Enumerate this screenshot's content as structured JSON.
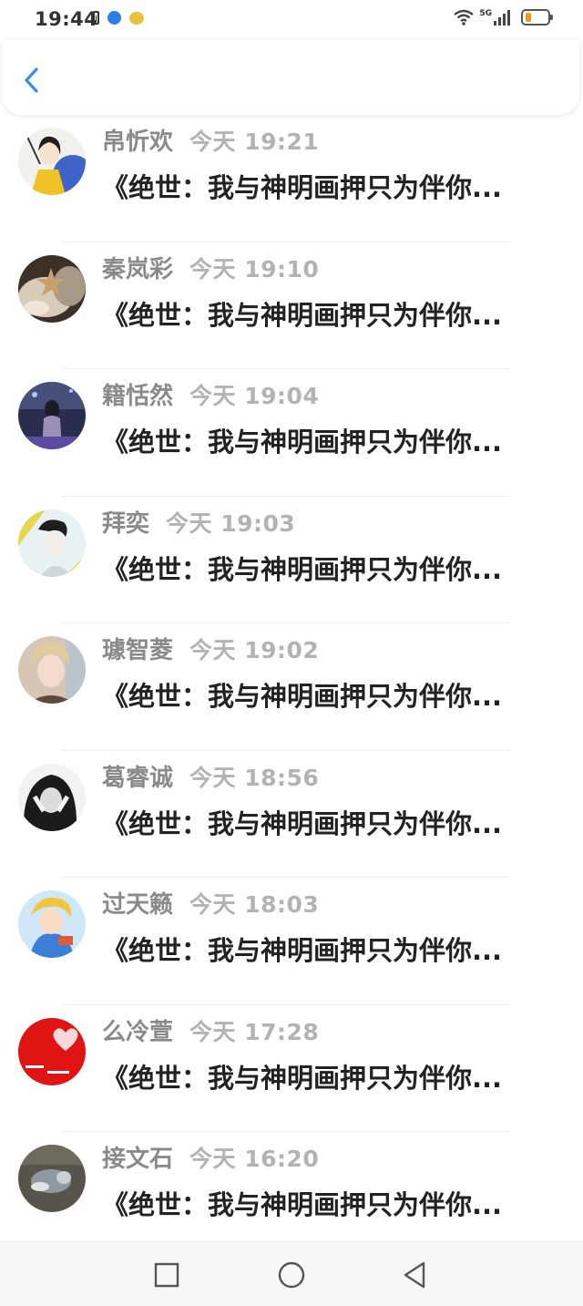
{
  "status_bar": {
    "time": "19:44",
    "network": "5G",
    "icons": [
      "battery-saver-icon",
      "browser-icon",
      "emoji-app-icon",
      "wifi-icon",
      "cellular-signal-icon",
      "battery-icon"
    ]
  },
  "header": {
    "back_icon": "chevron-left-icon",
    "accent_color": "#3a8de6"
  },
  "list": {
    "items": [
      {
        "name": "帛忻欢",
        "time": "今天 19:21",
        "title": "《绝世：我与神明画押只为伴你...",
        "avatar": "illustrated-woman-avatar"
      },
      {
        "name": "秦岚彩",
        "time": "今天 19:10",
        "title": "《绝世：我与神明画押只为伴你...",
        "avatar": "starfish-photo-avatar"
      },
      {
        "name": "籍恬然",
        "time": "今天 19:04",
        "title": "《绝世：我与神明画押只为伴你...",
        "avatar": "girl-night-avatar"
      },
      {
        "name": "拜奕",
        "time": "今天 19:03",
        "title": "《绝世：我与神明画押只为伴你...",
        "avatar": "boy-yellow-avatar"
      },
      {
        "name": "璩智菱",
        "time": "今天 19:02",
        "title": "《绝世：我与神明画押只为伴你...",
        "avatar": "young-man-avatar"
      },
      {
        "name": "葛睿诚",
        "time": "今天 18:56",
        "title": "《绝世：我与神明画押只为伴你...",
        "avatar": "black-white-girl-avatar"
      },
      {
        "name": "过天籁",
        "time": "今天 18:03",
        "title": "《绝世：我与神明画押只为伴你...",
        "avatar": "game-character-avatar"
      },
      {
        "name": "么冷萱",
        "time": "今天 17:28",
        "title": "《绝世：我与神明画押只为伴你...",
        "avatar": "red-heart-avatar"
      },
      {
        "name": "接文石",
        "time": "今天 16:20",
        "title": "《绝世：我与神明画押只为伴你...",
        "avatar": "cat-photo-avatar"
      }
    ]
  },
  "nav_bar": {
    "buttons": [
      "recent-apps-icon",
      "home-icon",
      "back-triangle-icon"
    ]
  }
}
